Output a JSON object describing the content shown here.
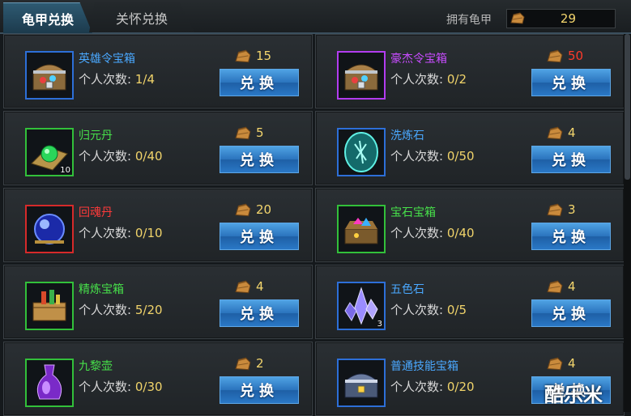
{
  "tabs": [
    {
      "label": "龟甲兑换",
      "active": true
    },
    {
      "label": "关怀兑换",
      "active": false
    }
  ],
  "owned": {
    "label": "拥有龟甲",
    "value": "29"
  },
  "count_label": "个人次数:",
  "exchange_label": "兑换",
  "items": [
    {
      "name": "英雄令宝箱",
      "name_color": "#4aa8ff",
      "frame_color": "#2d6fd8",
      "count": "1/4",
      "cost": "15",
      "cost_color": "#f4d66d",
      "qty": "",
      "icon": "treasure-chest-icon"
    },
    {
      "name": "豪杰令宝箱",
      "name_color": "#c84cff",
      "frame_color": "#b23cf0",
      "count": "0/2",
      "cost": "50",
      "cost_color": "#ff3a2a",
      "qty": "",
      "icon": "treasure-chest-icon"
    },
    {
      "name": "归元丹",
      "name_color": "#47e04a",
      "frame_color": "#32c03a",
      "count": "0/40",
      "cost": "5",
      "cost_color": "#f4d66d",
      "qty": "10",
      "icon": "green-pill-icon"
    },
    {
      "name": "洗炼石",
      "name_color": "#4aa8ff",
      "frame_color": "#2d6fd8",
      "count": "0/50",
      "cost": "4",
      "cost_color": "#f4d66d",
      "qty": "",
      "icon": "rune-stone-icon"
    },
    {
      "name": "回魂丹",
      "name_color": "#ff3a3a",
      "frame_color": "#d62a2a",
      "count": "0/10",
      "cost": "20",
      "cost_color": "#f4d66d",
      "qty": "",
      "icon": "blue-orb-icon"
    },
    {
      "name": "宝石宝箱",
      "name_color": "#47e04a",
      "frame_color": "#32c03a",
      "count": "0/40",
      "cost": "3",
      "cost_color": "#f4d66d",
      "qty": "",
      "icon": "gem-chest-icon"
    },
    {
      "name": "精炼宝箱",
      "name_color": "#47e04a",
      "frame_color": "#32c03a",
      "count": "5/20",
      "cost": "4",
      "cost_color": "#f4d66d",
      "qty": "",
      "icon": "refine-box-icon"
    },
    {
      "name": "五色石",
      "name_color": "#4aa8ff",
      "frame_color": "#2d6fd8",
      "count": "0/5",
      "cost": "4",
      "cost_color": "#f4d66d",
      "qty": "3",
      "icon": "crystal-icon"
    },
    {
      "name": "九黎壶",
      "name_color": "#47e04a",
      "frame_color": "#32c03a",
      "count": "0/30",
      "cost": "2",
      "cost_color": "#f4d66d",
      "qty": "",
      "icon": "purple-vase-icon"
    },
    {
      "name": "普通技能宝箱",
      "name_color": "#4aa8ff",
      "frame_color": "#2d6fd8",
      "count": "0/20",
      "cost": "4",
      "cost_color": "#f4d66d",
      "qty": "",
      "icon": "skill-chest-icon"
    }
  ],
  "watermark": "酷乐米"
}
